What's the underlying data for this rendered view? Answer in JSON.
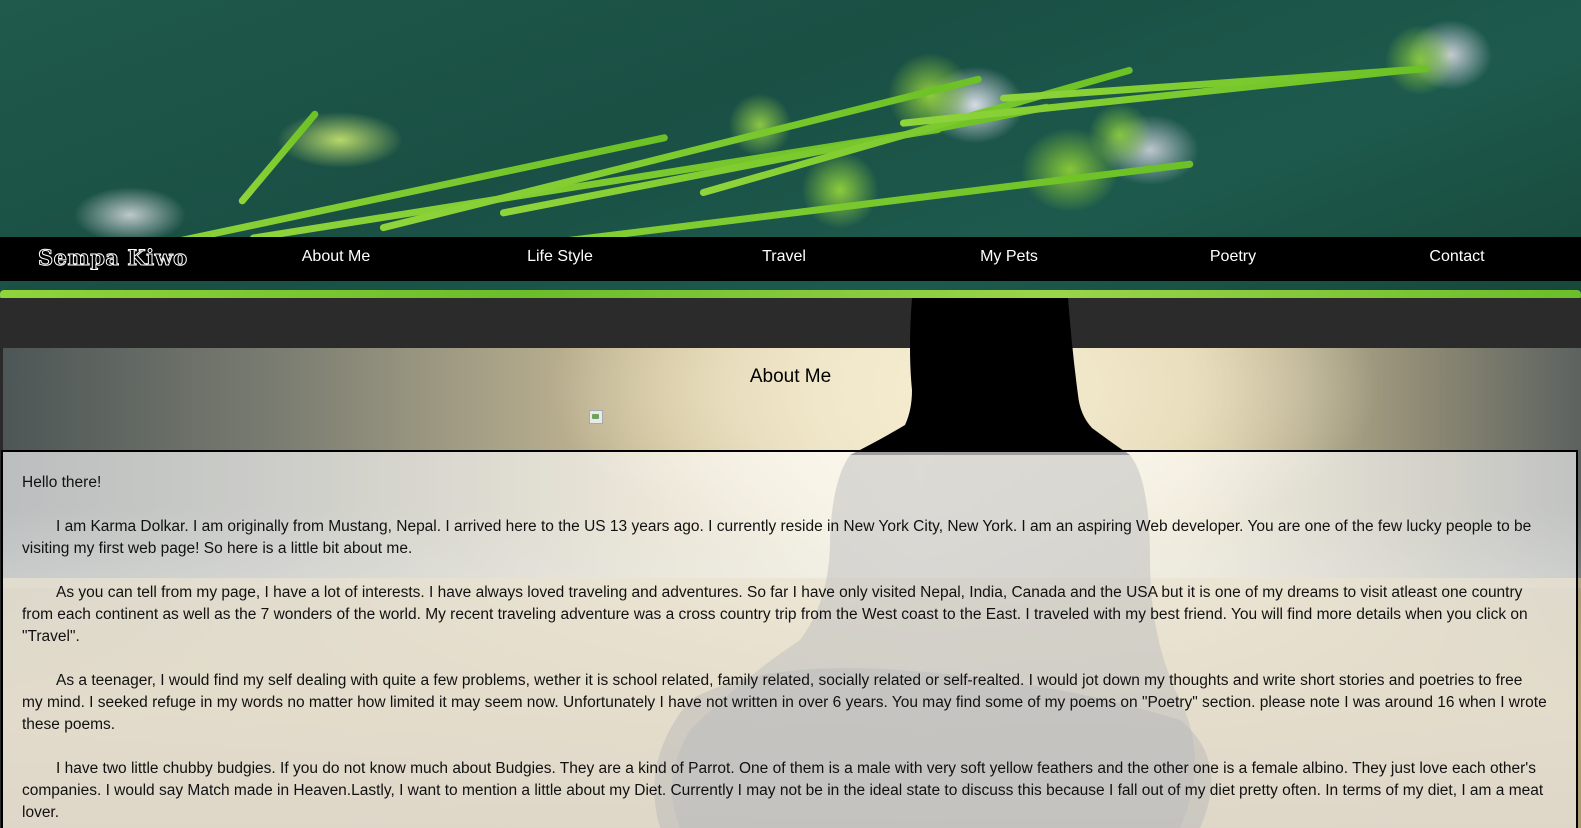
{
  "navbar": {
    "brand": "Sempa Kiwo",
    "items": [
      {
        "label": "About Me"
      },
      {
        "label": "Life Style"
      },
      {
        "label": "Travel"
      },
      {
        "label": "My Pets"
      },
      {
        "label": "Poetry"
      },
      {
        "label": "Contact"
      }
    ]
  },
  "page": {
    "title": "About Me"
  },
  "content": {
    "greeting": "Hello there!",
    "paragraphs": [
      "I am Karma Dolkar. I am originally from Mustang, Nepal. I arrived here to the US 13 years ago. I currently reside in New York City, New York. I am an aspiring Web developer. You are one of the few lucky people to be visiting my first web page! So here is a little bit about me.",
      "As you can tell from my page, I have a lot of interests. I have always loved traveling and adventures. So far I have only visited Nepal, India, Canada and the USA but it is one of my dreams to visit atleast one country from each continent as well as the 7 wonders of the world. My recent traveling adventure was a cross country trip from the West coast to the East. I traveled with my best friend. You will find more details when you click on \"Travel\".",
      "As a teenager, I would find my self dealing with quite a few problems, wether it is school related, family related, socially related or self-realted. I would jot down my thoughts and write short stories and poetries to free my mind. I seeked refuge in my words no matter how limited it may seem now. Unfortunately I have not written in over 6 years. You may find some of my poems on \"Poetry\" section. please note I was around 16 when I wrote these poems.",
      "I have two little chubby budgies. If you do not know much about Budgies. They are a kind of Parrot. One of them is a male with very soft yellow feathers and the other one is a female albino. They just love each other's companies. I would say Match made in Heaven.Lastly, I want to mention a little about my Diet. Currently I may not be in the ideal state to discuss this because I fall out of my diet pretty often. In terms of my diet, I am a meat lover."
    ]
  },
  "colors": {
    "navbar_bg": "#000000",
    "nav_text": "#ffffff",
    "dark_band": "#2b2b2b",
    "hero_green": "#1d5a4d"
  }
}
